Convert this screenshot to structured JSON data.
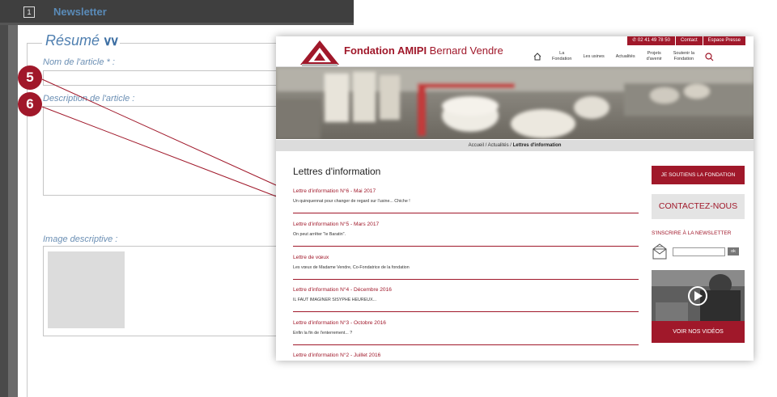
{
  "admin": {
    "step_number": "1",
    "header_title": "Newsletter",
    "legend": "Résumé",
    "fields": {
      "name_label": "Nom de l'article   * :",
      "description_label": "Description de l'article    :",
      "image_label": "Image descriptive    :"
    },
    "markers": [
      "5",
      "6"
    ]
  },
  "site": {
    "title_bold": "Fondation AMIPI",
    "title_light": " Bernard Vendre",
    "topbar": {
      "phone": "02 41 49 78 50",
      "contact": "Contact",
      "press": "Espace Presse"
    },
    "nav": [
      {
        "line1": "La",
        "line2": "Fondation"
      },
      {
        "line1": "Les usines",
        "line2": ""
      },
      {
        "line1": "Actualités",
        "line2": ""
      },
      {
        "line1": "Projets",
        "line2": "d'avenir"
      },
      {
        "line1": "Soutenir la",
        "line2": "Fondation"
      }
    ],
    "breadcrumb": {
      "home": "Accueil",
      "sep": "/",
      "news": "Actualités",
      "current": "Lettres d'information"
    },
    "page_title": "Lettres d'information",
    "articles": [
      {
        "title": "Lettre d'information N°6 - Mai 2017",
        "desc": "Un quinquennat pour changer de regard sur l'usine... Chiche !"
      },
      {
        "title": "Lettre d'information N°5 - Mars 2017",
        "desc": "On peut arrêter \"le Baratin\"."
      },
      {
        "title": "Lettre de vœux",
        "desc": "Les vœux de Madame Vendre, Co-Fondatrice de la fondation"
      },
      {
        "title": "Lettre d'information N°4 - Décembre 2016",
        "desc": "IL FAUT IMAGINER SISYPHE HEUREUX..."
      },
      {
        "title": "Lettre d'information N°3 - Octobre 2016",
        "desc": "Enfin la fin de l'enterrement... ?"
      },
      {
        "title": "Lettre d'information N°2 - Juillet 2016",
        "desc": ""
      }
    ],
    "sidebar": {
      "support": "JE SOUTIENS LA FONDATION",
      "contact": "CONTACTEZ-NOUS",
      "newsletter": "S'INSCRIRE À LA NEWSLETTER",
      "ok": "ok",
      "videos": "VOIR NOS VIDÉOS"
    }
  },
  "colors": {
    "brand_red": "#a0182a",
    "admin_blue": "#4f7fb0"
  }
}
